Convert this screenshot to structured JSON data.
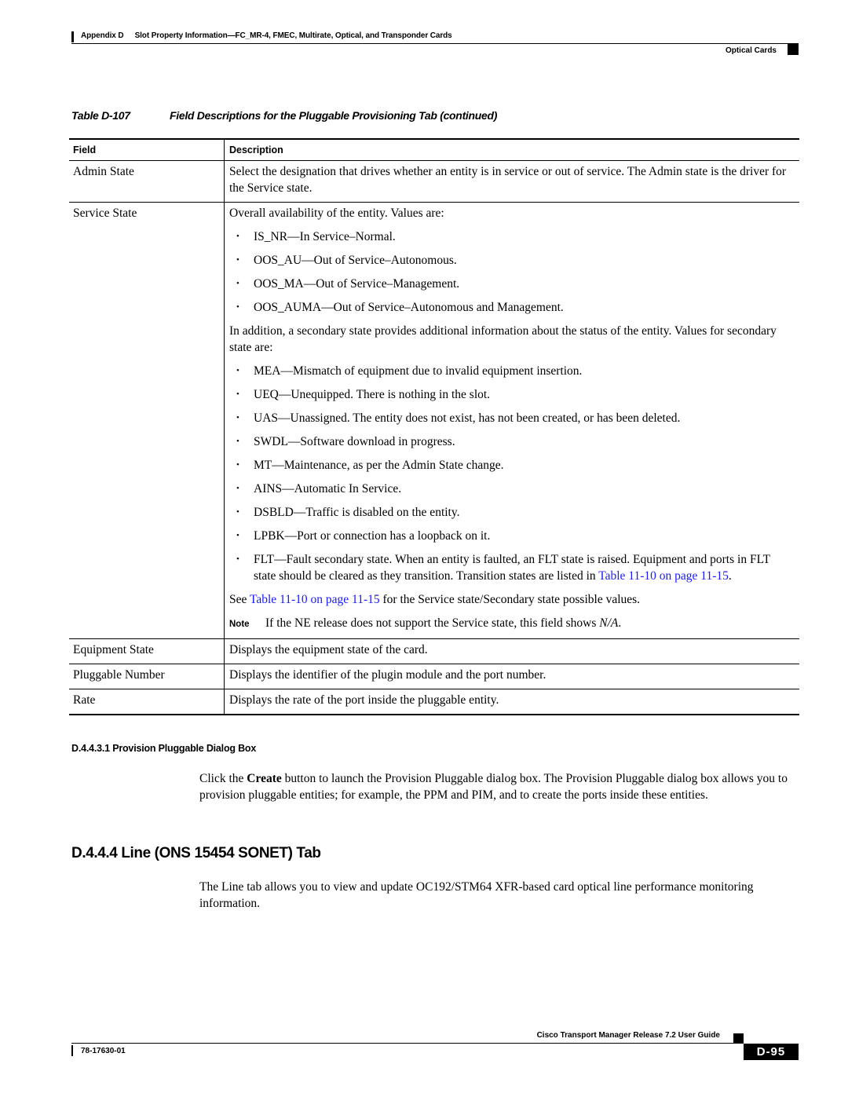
{
  "header": {
    "appendix": "Appendix D",
    "title": "Slot Property Information—FC_MR-4, FMEC, Multirate, Optical, and Transponder Cards",
    "section": "Optical Cards"
  },
  "table": {
    "number": "Table D-107",
    "caption": "Field Descriptions for the Pluggable Provisioning Tab (continued)",
    "columns": [
      "Field",
      "Description"
    ],
    "rows": {
      "admin_state": {
        "field": "Admin State",
        "description": "Select the designation that drives whether an entity is in service or out of service. The Admin state is the driver for the Service state."
      },
      "service_state": {
        "field": "Service State",
        "intro": "Overall availability of the entity. Values are:",
        "primary_values": [
          "IS_NR—In Service–Normal.",
          "OOS_AU—Out of Service–Autonomous.",
          "OOS_MA—Out of Service–Management.",
          "OOS_AUMA—Out of Service–Autonomous and Management."
        ],
        "secondary_intro": "In addition, a secondary state provides additional information about the status of the entity. Values for secondary state are:",
        "secondary_values": [
          "MEA—Mismatch of equipment due to invalid equipment insertion.",
          "UEQ—Unequipped. There is nothing in the slot.",
          "UAS—Unassigned. The entity does not exist, has not been created, or has been deleted.",
          "SWDL—Software download in progress.",
          "MT—Maintenance, as per the Admin State change.",
          "AINS—Automatic In Service.",
          "DSBLD—Traffic is disabled on the entity.",
          "LPBK—Port or connection has a loopback on it."
        ],
        "flt_text": "FLT—Fault secondary state. When an entity is faulted, an FLT state is raised. Equipment and ports in FLT state should be cleared as they transition. Transition states are listed in ",
        "flt_link": "Table 11-10 on page 11-15",
        "flt_end": ".",
        "see_prefix": "See ",
        "see_link": "Table 11-10 on page 11-15",
        "see_suffix": " for the Service state/Secondary state possible values.",
        "note_label": "Note",
        "note_text": "If the NE release does not support the Service state, this field shows ",
        "note_value": "N/A",
        "note_end": "."
      },
      "equipment_state": {
        "field": "Equipment State",
        "description": "Displays the equipment state of the card."
      },
      "pluggable_number": {
        "field": "Pluggable Number",
        "description": "Displays the identifier of the plugin module and the port number."
      },
      "rate": {
        "field": "Rate",
        "description": "Displays the rate of the port inside the pluggable entity."
      }
    }
  },
  "section_provision": {
    "heading": "D.4.4.3.1  Provision Pluggable Dialog Box",
    "text_before": "Click the ",
    "bold_word": "Create",
    "text_after": " button to launch the Provision Pluggable dialog box. The Provision Pluggable dialog box allows you to provision pluggable entities; for example, the PPM and PIM, and to create the ports inside these entities."
  },
  "section_line": {
    "heading": "D.4.4.4  Line (ONS 15454 SONET) Tab",
    "text": "The Line tab allows you to view and update OC192/STM64 XFR-based card optical line performance monitoring information."
  },
  "footer": {
    "guide_title": "Cisco Transport Manager Release 7.2 User Guide",
    "doc_number": "78-17630-01",
    "page": "D-95"
  },
  "colors": {
    "link": "#1a1aff",
    "text": "#000000"
  }
}
